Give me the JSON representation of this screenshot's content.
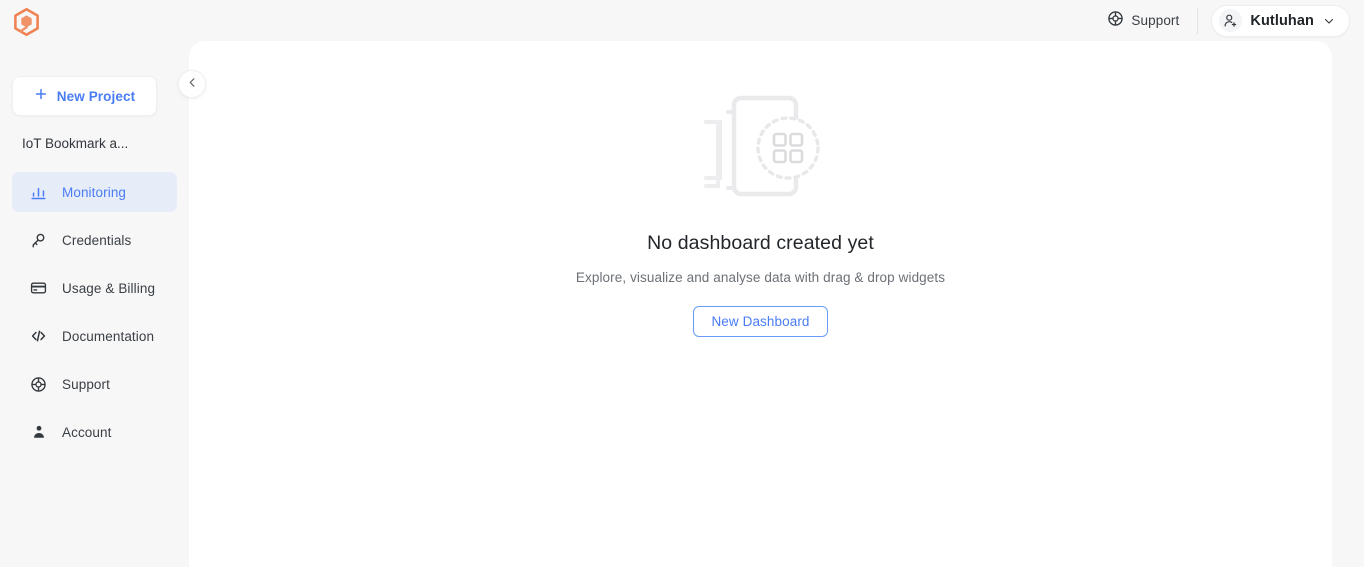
{
  "topbar": {
    "logo_icon": "hexagon-logo-icon",
    "logo_color": "#ef8354",
    "support": {
      "label": "Support",
      "icon": "lifebuoy-icon"
    },
    "user": {
      "name": "Kutluhan",
      "avatar_icon": "add-user-icon",
      "chevron_icon": "chevron-down-icon"
    }
  },
  "sidebar": {
    "new_project": {
      "label": "New Project",
      "icon": "plus-icon"
    },
    "project_name": "IoT Bookmark a...",
    "items": [
      {
        "label": "Monitoring",
        "icon": "bar-chart-icon",
        "active": true
      },
      {
        "label": "Credentials",
        "icon": "key-icon",
        "active": false
      },
      {
        "label": "Usage & Billing",
        "icon": "credit-card-icon",
        "active": false
      },
      {
        "label": "Documentation",
        "icon": "code-icon",
        "active": false
      },
      {
        "label": "Support",
        "icon": "lifebuoy-icon",
        "active": false
      },
      {
        "label": "Account",
        "icon": "person-icon",
        "active": false
      }
    ],
    "collapse_button_icon": "chevron-left-icon"
  },
  "main": {
    "illustration_icon": "empty-dashboard-illustration",
    "title": "No dashboard created yet",
    "subtitle": "Explore, visualize and analyse data with drag & drop widgets",
    "cta_label": "New Dashboard"
  },
  "colors": {
    "accent_blue": "#4a7cf5",
    "brand_orange": "#ef8354",
    "page_background": "#f7f7f8",
    "panel_background": "#ffffff",
    "active_item_background": "#e6edf9"
  }
}
